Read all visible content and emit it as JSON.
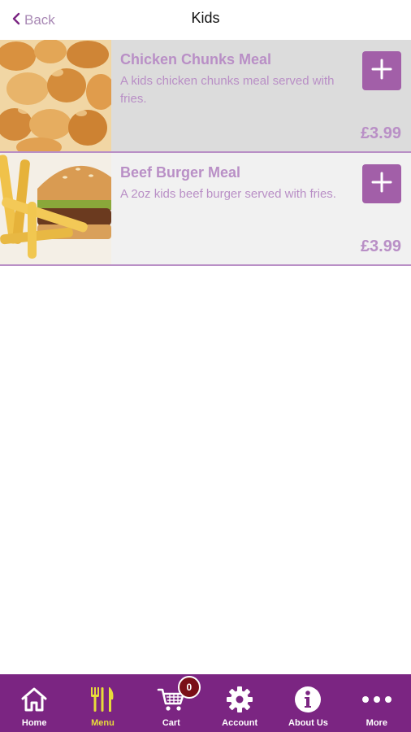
{
  "header": {
    "back_label": "Back",
    "title": "Kids"
  },
  "items": [
    {
      "name": "Chicken Chunks Meal",
      "description": "A kids chicken chunks meal served with fries.",
      "price": "£3.99"
    },
    {
      "name": "Beef Burger Meal",
      "description": "A 2oz kids beef burger served with fries.",
      "price": "£3.99"
    }
  ],
  "tabbar": {
    "tabs": [
      {
        "label": "Home",
        "icon": "home-icon"
      },
      {
        "label": "Menu",
        "icon": "cutlery-icon",
        "active": true
      },
      {
        "label": "Cart",
        "icon": "cart-icon",
        "badge": "0"
      },
      {
        "label": "Account",
        "icon": "gear-icon"
      },
      {
        "label": "About Us",
        "icon": "info-icon"
      },
      {
        "label": "More",
        "icon": "more-icon"
      }
    ]
  },
  "colors": {
    "brand_purple": "#7b2582",
    "add_button": "#a25fa8",
    "item_text": "#b98fc6",
    "active_tab": "#e7dc3a",
    "badge": "#7a0f17"
  }
}
